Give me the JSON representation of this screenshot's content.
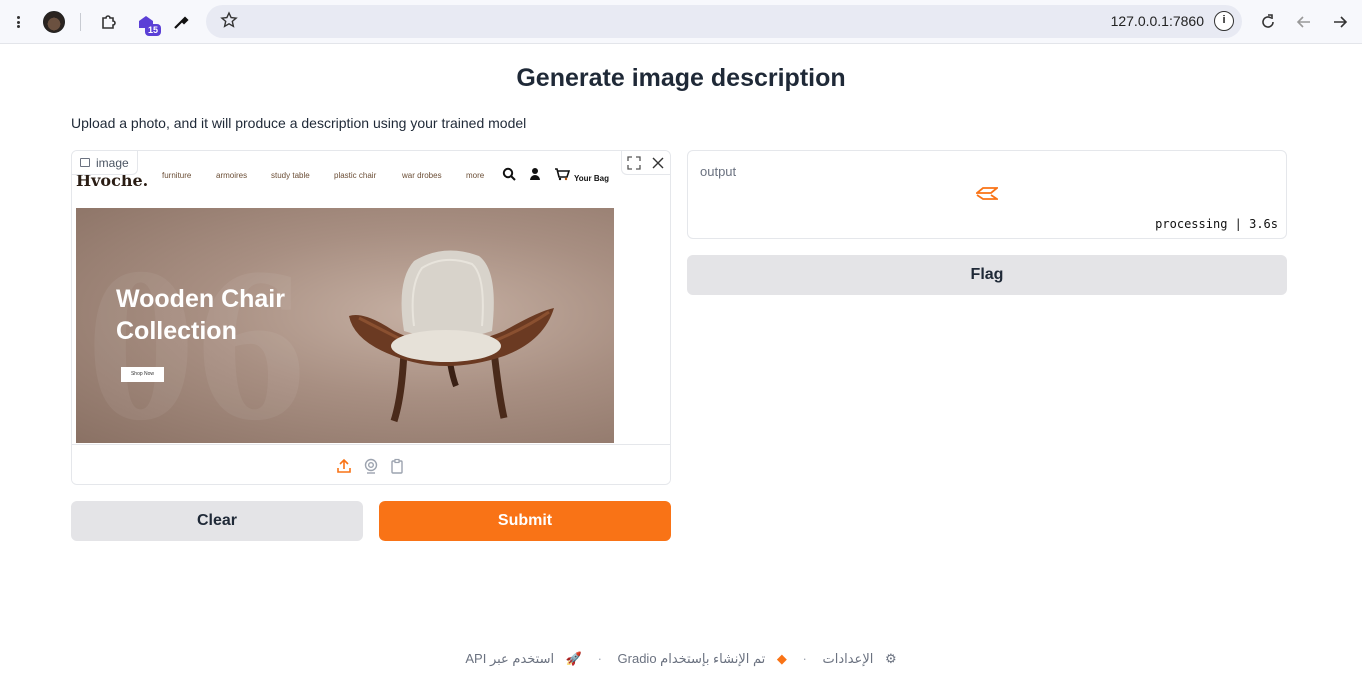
{
  "browser": {
    "url": "127.0.0.1:7860",
    "extension_badge": "15",
    "icons": [
      "menu-icon",
      "avatar",
      "puzzle-icon",
      "extension-icon",
      "eyedropper-icon",
      "star-icon",
      "info-icon",
      "reload-icon",
      "back-icon",
      "forward-icon"
    ]
  },
  "page": {
    "title": "Generate image description",
    "description": "Upload a photo, and it will produce a description using your trained model"
  },
  "image_input": {
    "label": "image",
    "site": {
      "logo": "Hvoche.",
      "nav": [
        "furniture",
        "armoires",
        "study table",
        "plastic chair",
        "war drobes",
        "more"
      ],
      "bag_label": "Your Bag",
      "hero_line1": "Wooden Chair",
      "hero_line2": "Collection",
      "shop_button": "Shop Now"
    }
  },
  "buttons": {
    "clear": "Clear",
    "submit": "Submit",
    "flag": "Flag"
  },
  "output": {
    "label": "output",
    "status": "processing | 3.6s"
  },
  "footer": {
    "api": "استخدم عبر API",
    "built_with": "تم الإنشاء بإستخدام Gradio",
    "settings": "الإعدادات"
  },
  "colors": {
    "accent": "#f97316",
    "secondary_button": "#e4e4e7"
  }
}
